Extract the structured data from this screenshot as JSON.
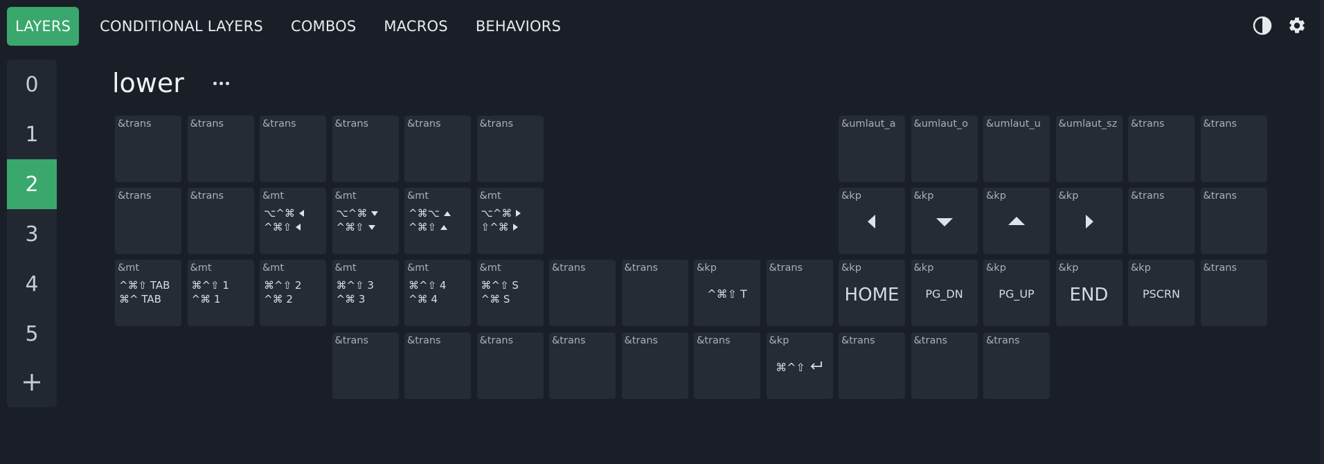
{
  "nav": {
    "tabs": [
      {
        "label": "LAYERS"
      },
      {
        "label": "CONDITIONAL LAYERS"
      },
      {
        "label": "COMBOS"
      },
      {
        "label": "MACROS"
      },
      {
        "label": "BEHAVIORS"
      }
    ],
    "active_tab": 0,
    "icons": [
      "theme-toggle-icon",
      "gear-icon"
    ]
  },
  "sidebar": {
    "layers": [
      "0",
      "1",
      "2",
      "3",
      "4",
      "5"
    ],
    "active_layer": 2,
    "add_icon": "plus-icon"
  },
  "layer": {
    "name": "lower",
    "more_icon": "ellipsis-icon"
  },
  "colors": {
    "accent": "#3aa76d",
    "background": "#1a1f27",
    "key_bg": "#252c35"
  },
  "keys": {
    "r0": [
      {
        "b": "&trans"
      },
      {
        "b": "&trans"
      },
      {
        "b": "&trans"
      },
      {
        "b": "&trans"
      },
      {
        "b": "&trans"
      },
      {
        "b": "&trans"
      },
      {
        "b": "&umlaut_a"
      },
      {
        "b": "&umlaut_o"
      },
      {
        "b": "&umlaut_u"
      },
      {
        "b": "&umlaut_sz"
      },
      {
        "b": "&trans"
      },
      {
        "b": "&trans"
      }
    ],
    "r1": [
      {
        "b": "&trans"
      },
      {
        "b": "&trans"
      },
      {
        "b": "&mt",
        "l1": "⌥^⌘",
        "i1": "left",
        "l2": "^⌘⇧",
        "i2": "left"
      },
      {
        "b": "&mt",
        "l1": "⌥^⌘",
        "i1": "down",
        "l2": "^⌘⇧",
        "i2": "down"
      },
      {
        "b": "&mt",
        "l1": "^⌘⌥",
        "i1": "up",
        "l2": "^⌘⇧",
        "i2": "up"
      },
      {
        "b": "&mt",
        "l1": "⌥^⌘",
        "i1": "right",
        "l2": "⇧^⌘",
        "i2": "right"
      },
      {
        "b": "&kp",
        "arrow": "left"
      },
      {
        "b": "&kp",
        "arrow": "down"
      },
      {
        "b": "&kp",
        "arrow": "up"
      },
      {
        "b": "&kp",
        "arrow": "right"
      },
      {
        "b": "&trans"
      },
      {
        "b": "&trans"
      }
    ],
    "r2": [
      {
        "b": "&mt",
        "l1": "^⌘⇧  TAB",
        "l2": "⌘^  TAB"
      },
      {
        "b": "&mt",
        "l1": "⌘^⇧  1",
        "l2": "^⌘  1"
      },
      {
        "b": "&mt",
        "l1": "⌘^⇧  2",
        "l2": "^⌘  2"
      },
      {
        "b": "&mt",
        "l1": "⌘^⇧  3",
        "l2": "^⌘  3"
      },
      {
        "b": "&mt",
        "l1": "⌘^⇧  4",
        "l2": "^⌘  4"
      },
      {
        "b": "&mt",
        "l1": "⌘^⇧  S",
        "l2": "^⌘  S"
      },
      {
        "b": "&trans"
      },
      {
        "b": "&trans"
      },
      {
        "b": "&kp",
        "mid": "^⌘⇧  T"
      },
      {
        "b": "&trans"
      },
      {
        "b": "&kp",
        "big": "HOME"
      },
      {
        "b": "&kp",
        "mid": "PG_DN"
      },
      {
        "b": "&kp",
        "mid": "PG_UP"
      },
      {
        "b": "&kp",
        "big": "END"
      },
      {
        "b": "&kp",
        "mid": "PSCRN"
      },
      {
        "b": "&trans"
      }
    ],
    "r3": [
      {
        "b": "&trans"
      },
      {
        "b": "&trans"
      },
      {
        "b": "&trans"
      },
      {
        "b": "&trans"
      },
      {
        "b": "&trans"
      },
      {
        "b": "&trans"
      },
      {
        "b": "&kp",
        "mid": "⌘^⇧",
        "ret": true
      },
      {
        "b": "&trans"
      },
      {
        "b": "&trans"
      },
      {
        "b": "&trans"
      }
    ]
  }
}
